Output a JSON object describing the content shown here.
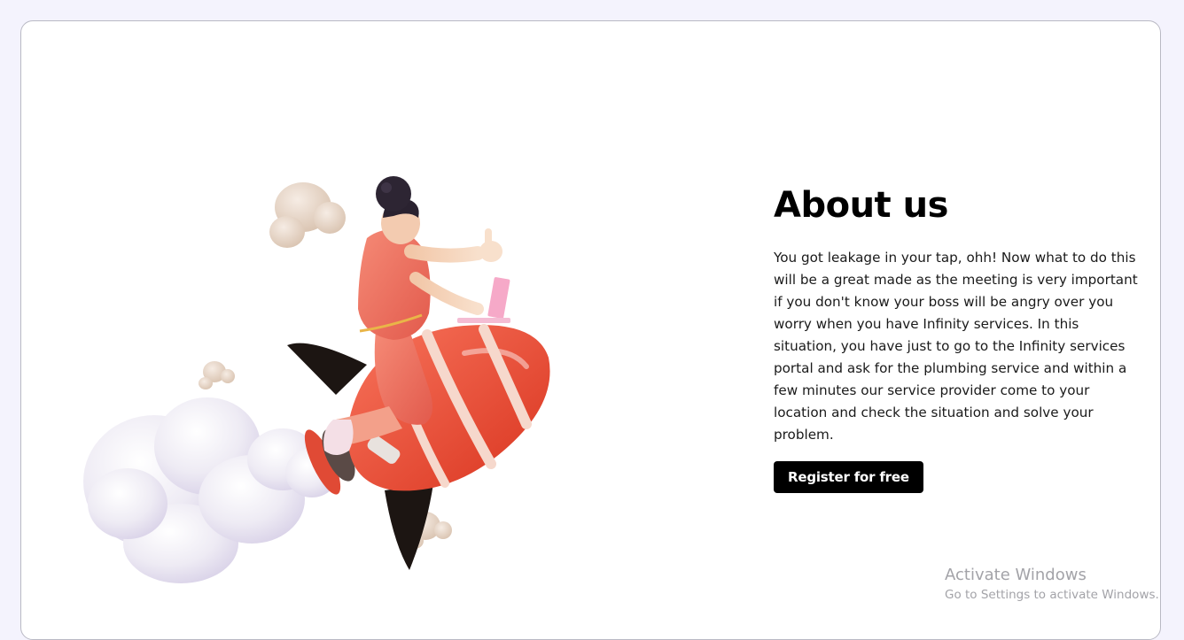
{
  "about": {
    "heading": "About us",
    "description": "You got leakage in your tap, ohh! Now what to do this will be a great made as the meeting is very important if you don't know your boss will be angry over you worry when you have Infinity services. In this situation, you have just to go to the Infinity services portal and ask for the plumbing service and within a few minutes our service provider come to your location and check the situation and solve your problem.",
    "cta_label": "Register for free"
  },
  "illustration": {
    "icon": "rocket-rider-illustration"
  },
  "watermark": {
    "title": "Activate Windows",
    "subtitle": "Go to Settings to activate Windows."
  },
  "colors": {
    "page_background": "#f4f3fd",
    "card_background": "#ffffff",
    "rocket": "#ee4b35",
    "shirt": "#ef6d5e",
    "button_background": "#000000",
    "button_text": "#ffffff"
  }
}
